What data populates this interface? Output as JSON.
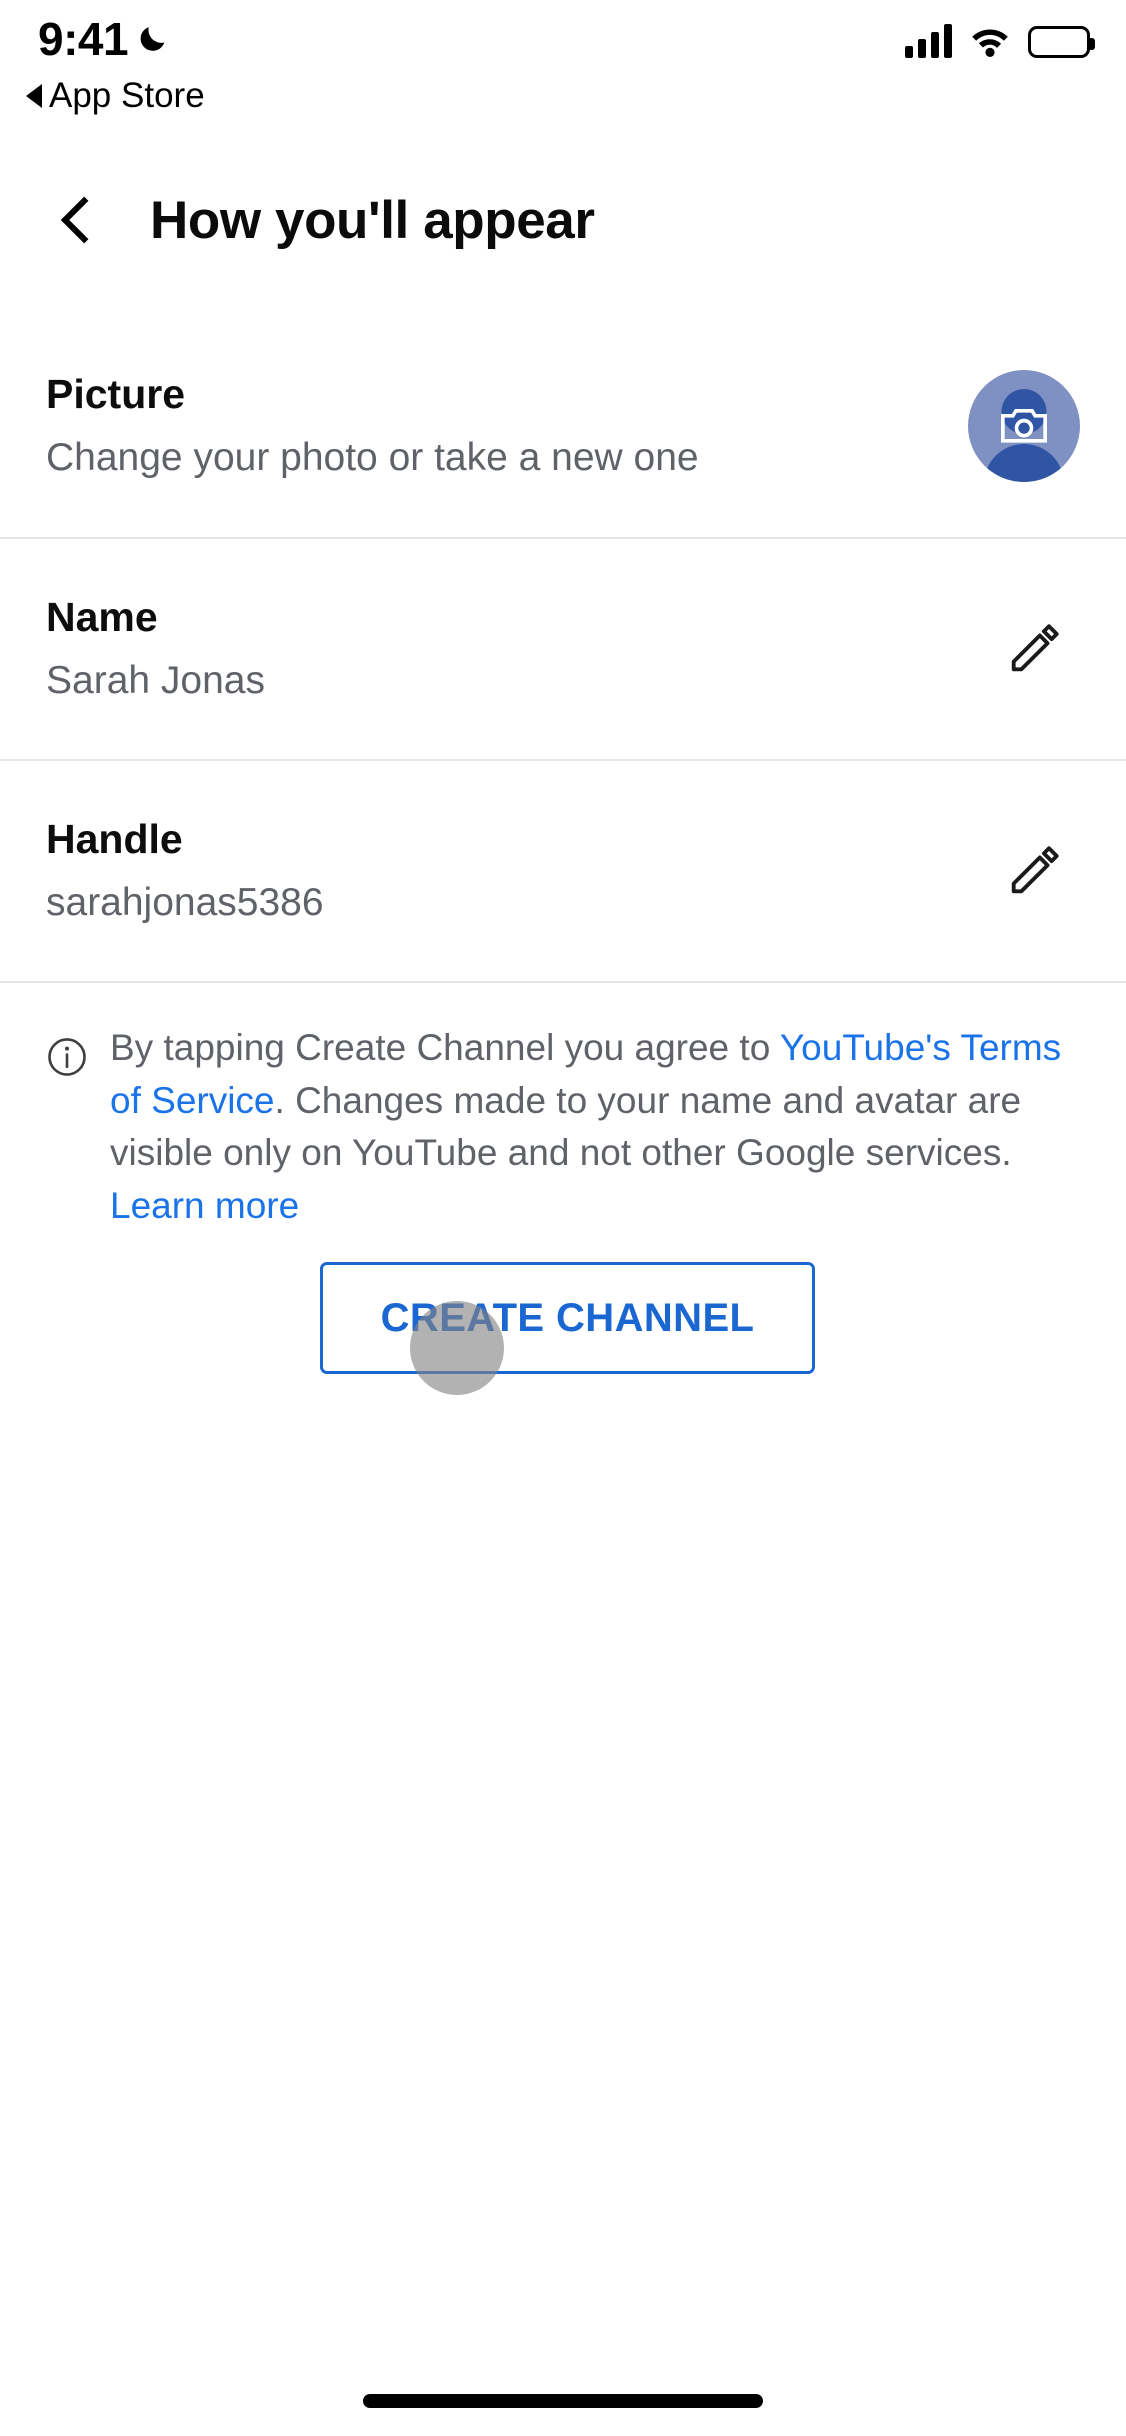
{
  "status_bar": {
    "time": "9:41",
    "dnd_icon": "crescent-moon-icon",
    "back_app_label": "App Store",
    "back_app_arrow": "triangle-left-icon",
    "signal_icon": "cellular-signal-icon",
    "wifi_icon": "wifi-icon",
    "battery_icon": "battery-full-icon"
  },
  "nav": {
    "back_icon": "chevron-left-icon",
    "title": "How you'll appear"
  },
  "rows": {
    "picture": {
      "title": "Picture",
      "subtitle": "Change your photo or take a new one",
      "avatar_icon": "avatar-camera-icon",
      "avatar_bg_color": "#7f91c2",
      "avatar_person_color": "#2f55a4"
    },
    "name": {
      "title": "Name",
      "value": "Sarah Jonas",
      "edit_icon": "pencil-icon"
    },
    "handle": {
      "title": "Handle",
      "value": "sarahjonas5386",
      "edit_icon": "pencil-icon"
    }
  },
  "disclaimer": {
    "info_icon": "info-circle-icon",
    "part1": "By tapping Create Channel you agree to ",
    "link1": "YouTube's Terms of Service",
    "part2": ". Changes made to your name and avatar are visible only on YouTube and not other Google services. ",
    "link2": "Learn more",
    "link_color": "#1a73e8",
    "text_color": "#5f6368"
  },
  "create_button": {
    "label": "CREATE CHANNEL",
    "accent_color": "#1a67d2"
  },
  "touch_indicator": {
    "name": "tap-indicator",
    "color": "rgba(130,130,130,0.62)"
  },
  "home_indicator": {
    "name": "home-indicator"
  }
}
